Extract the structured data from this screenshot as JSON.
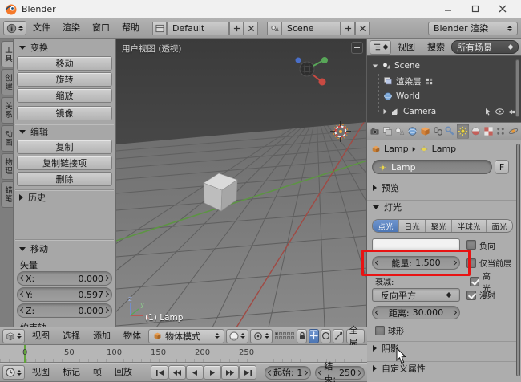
{
  "titlebar": {
    "title": "Blender"
  },
  "topbar": {
    "menus": [
      "文件",
      "渲染",
      "窗口",
      "帮助"
    ],
    "layout": {
      "value": "Default"
    },
    "scene": {
      "value": "Scene"
    },
    "engine": {
      "value": "Blender 渲染"
    }
  },
  "tool_tabs": [
    {
      "label": "工具"
    },
    {
      "label": "创建"
    },
    {
      "label": "关系"
    },
    {
      "label": "动画"
    },
    {
      "label": "物理"
    },
    {
      "label": "蜡笔"
    }
  ],
  "tool_shelf": {
    "transform": {
      "title": "变换",
      "buttons": [
        "移动",
        "旋转",
        "缩放",
        "镜像"
      ]
    },
    "edit": {
      "title": "编辑",
      "buttons": [
        "复制",
        "复制链接项",
        "删除"
      ]
    },
    "history": {
      "title": "历史"
    },
    "operator": {
      "title": "移动",
      "vector_label": "矢量",
      "x_label": "X:",
      "x_value": "0.000",
      "y_label": "Y:",
      "y_value": "0.597",
      "z_label": "Z:",
      "z_value": "0.000",
      "constraint_label": "约束轴"
    }
  },
  "viewport": {
    "view_label": "用户视图 (透视)",
    "active_object": "(1) Lamp",
    "axis": {
      "x": "x",
      "y": "y",
      "z": "z"
    },
    "header": {
      "menus": [
        "视图",
        "选择",
        "添加",
        "物体"
      ],
      "mode": "物体模式",
      "orientation": "全局"
    }
  },
  "timeline": {
    "ticks": [
      "0",
      "50",
      "100",
      "150",
      "200",
      "250"
    ],
    "menus": [
      "视图",
      "标记",
      "帧",
      "回放"
    ],
    "start_label": "起始:",
    "start_value": "1",
    "end_label": "结束:",
    "end_value": "250"
  },
  "outliner": {
    "menus": [
      "视图",
      "搜索"
    ],
    "display_mode": "所有场景",
    "items": [
      "Scene",
      "渲染层",
      "World",
      "Camera"
    ]
  },
  "properties": {
    "breadcrumb": {
      "first": "Lamp",
      "second": "Lamp"
    },
    "name_value": "Lamp",
    "fake_user": "F",
    "preview_title": "预览",
    "lamp_title": "灯光",
    "lamp_types": [
      "点光",
      "日光",
      "聚光",
      "半球光",
      "面光"
    ],
    "negative_label": "负向",
    "energy_label": "能量:",
    "energy_value": "1.500",
    "this_layer_label": "仅当前层",
    "falloff_label": "衰减:",
    "specular_label": "高光",
    "falloff_value": "反向平方",
    "diffuse_label": "漫射",
    "distance_label": "距离:",
    "distance_value": "30.000",
    "sphere_label": "球形",
    "shadow_title": "阴影",
    "custom_title": "自定义属性"
  },
  "colors": {
    "accent_blue": "#5680c2",
    "annotation_red": "#e81313",
    "lamp_color": "#ffffff"
  }
}
